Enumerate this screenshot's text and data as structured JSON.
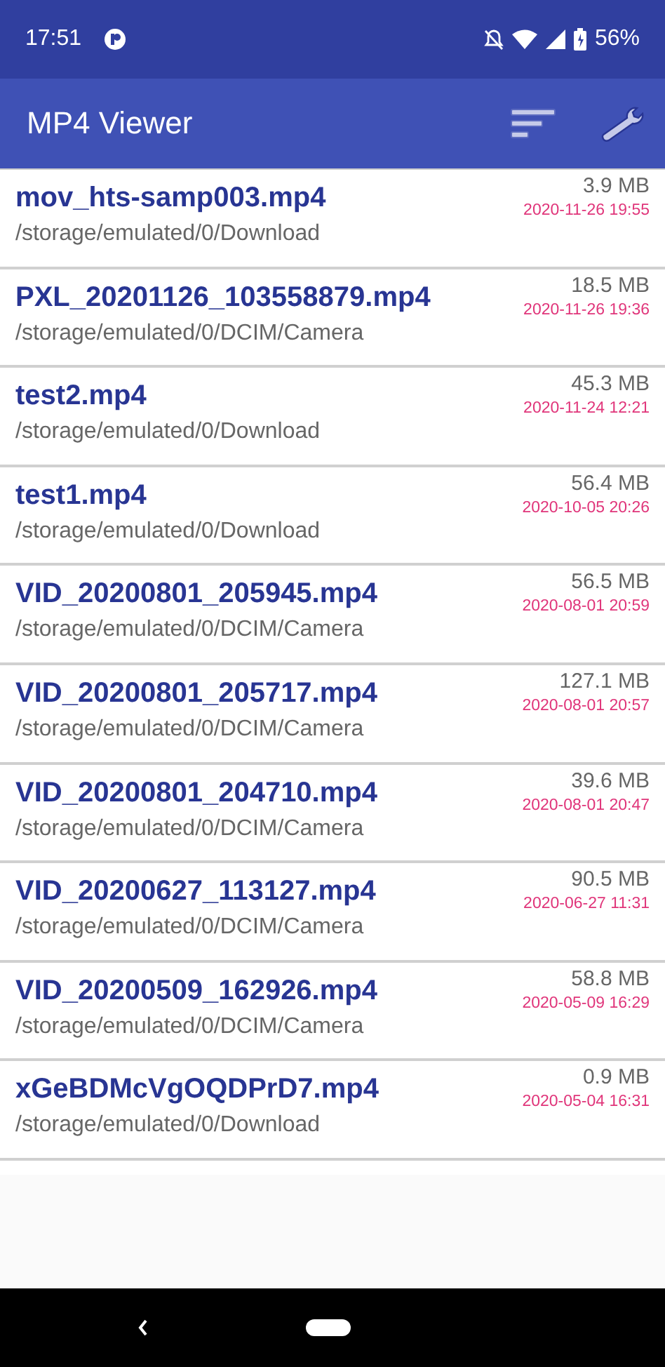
{
  "status_bar": {
    "time": "17:51",
    "battery": "56%"
  },
  "app_bar": {
    "title": "MP4 Viewer"
  },
  "files": [
    {
      "name": "mov_hts-samp003.mp4",
      "path": "/storage/emulated/0/Download",
      "size": "3.9 MB",
      "date": "2020-11-26 19:55"
    },
    {
      "name": "PXL_20201126_103558879.mp4",
      "path": "/storage/emulated/0/DCIM/Camera",
      "size": "18.5 MB",
      "date": "2020-11-26 19:36"
    },
    {
      "name": "test2.mp4",
      "path": "/storage/emulated/0/Download",
      "size": "45.3 MB",
      "date": "2020-11-24 12:21"
    },
    {
      "name": "test1.mp4",
      "path": "/storage/emulated/0/Download",
      "size": "56.4 MB",
      "date": "2020-10-05 20:26"
    },
    {
      "name": "VID_20200801_205945.mp4",
      "path": "/storage/emulated/0/DCIM/Camera",
      "size": "56.5 MB",
      "date": "2020-08-01 20:59"
    },
    {
      "name": "VID_20200801_205717.mp4",
      "path": "/storage/emulated/0/DCIM/Camera",
      "size": "127.1 MB",
      "date": "2020-08-01 20:57"
    },
    {
      "name": "VID_20200801_204710.mp4",
      "path": "/storage/emulated/0/DCIM/Camera",
      "size": "39.6 MB",
      "date": "2020-08-01 20:47"
    },
    {
      "name": "VID_20200627_113127.mp4",
      "path": "/storage/emulated/0/DCIM/Camera",
      "size": "90.5 MB",
      "date": "2020-06-27 11:31"
    },
    {
      "name": "VID_20200509_162926.mp4",
      "path": "/storage/emulated/0/DCIM/Camera",
      "size": "58.8 MB",
      "date": "2020-05-09 16:29"
    },
    {
      "name": "xGeBDMcVgOQDPrD7.mp4",
      "path": "/storage/emulated/0/Download",
      "size": "0.9 MB",
      "date": "2020-05-04 16:31"
    }
  ]
}
